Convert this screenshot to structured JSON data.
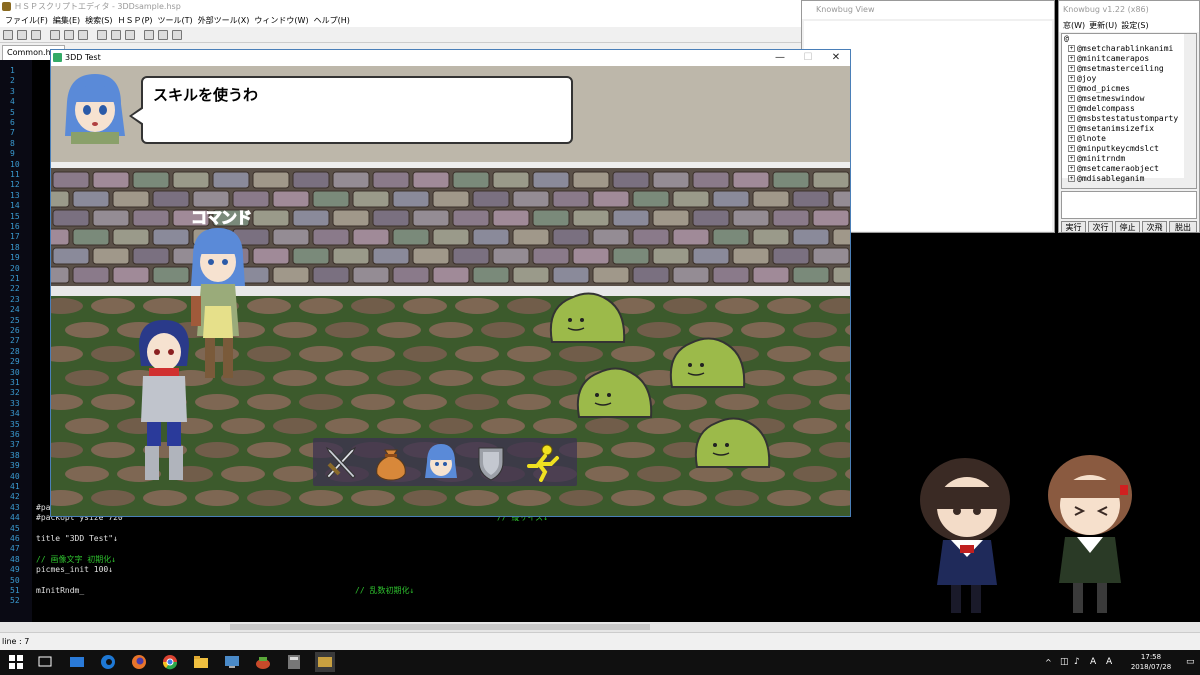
{
  "editor": {
    "title": "ＨＳＰスクリプトエディタ - 3DDsample.hsp",
    "menu": [
      "ファイル(F)",
      "編集(E)",
      "検索(S)",
      "ＨＳＰ(P)",
      "ツール(T)",
      "外部ツール(X)",
      "ウィンドウ(W)",
      "ヘルプ(H)"
    ],
    "tab": "Common.hsp",
    "line_numbers": [
      "1",
      "2",
      "3",
      "4",
      "5",
      "6",
      "7",
      "8",
      "9",
      "10",
      "11",
      "12",
      "13",
      "14",
      "15",
      "16",
      "17",
      "18",
      "19",
      "20",
      "21",
      "22",
      "23",
      "24",
      "25",
      "26",
      "27",
      "28",
      "29",
      "30",
      "31",
      "32",
      "33",
      "34",
      "35",
      "36",
      "37",
      "38",
      "39",
      "40",
      "41",
      "42",
      "43",
      "44",
      "45",
      "46",
      "47",
      "48",
      "49",
      "50",
      "51",
      "52"
    ],
    "code_lines": [
      {
        "n": "43",
        "text": "#packopt xsize 1280",
        "comment": "// 横サイズ↓"
      },
      {
        "n": "44",
        "text": "#packopt ysize 720",
        "comment": "// 縦サイズ↓"
      },
      {
        "n": "46",
        "text": "title \"3DD Test\"↓",
        "comment": ""
      },
      {
        "n": "48",
        "text": "",
        "comment": "// 画像文字 初期化↓"
      },
      {
        "n": "49",
        "text": "picmes_init 100↓",
        "comment": ""
      },
      {
        "n": "51",
        "text": "mInitRndm_",
        "comment": "// 乱数初期化↓"
      }
    ],
    "status": "line : 7"
  },
  "knowbug_view": {
    "title": "Knowbug View"
  },
  "knowbug": {
    "title": "Knowbug v1.22 (x86)",
    "menu": [
      "窓(W)",
      "更新(U)",
      "設定(S)"
    ],
    "root": "@",
    "tree": [
      "@msetcharablinkanimi",
      "@minitcamerapos",
      "@msetmasterceiling",
      "@joy",
      "@mod_picmes",
      "@msetmeswindow",
      "@mdelcompass",
      "@msbstestatustomparty",
      "@msetanimsizefix",
      "@lnote",
      "@minputkeycmdslct",
      "@minitrndm",
      "@msetcameraobject",
      "@mdisableganim"
    ],
    "buttons": [
      "実行",
      "次行",
      "停止",
      "次飛",
      "脱出"
    ]
  },
  "game": {
    "title": "3DD Test",
    "message": "スキルを使うわ",
    "command_label": "コマンド",
    "commands": [
      "attack-sword-icon",
      "item-bag-icon",
      "character-portrait-icon",
      "defend-shield-icon",
      "escape-run-icon"
    ]
  },
  "taskbar": {
    "time": "17:58",
    "date": "2018/07/28"
  },
  "colors": {
    "code_bg": "#000000",
    "comment": "#2ec02e",
    "line_number": "#3a9ad0",
    "floor": "#3c5a2c",
    "wall": "#bdb7aa"
  }
}
